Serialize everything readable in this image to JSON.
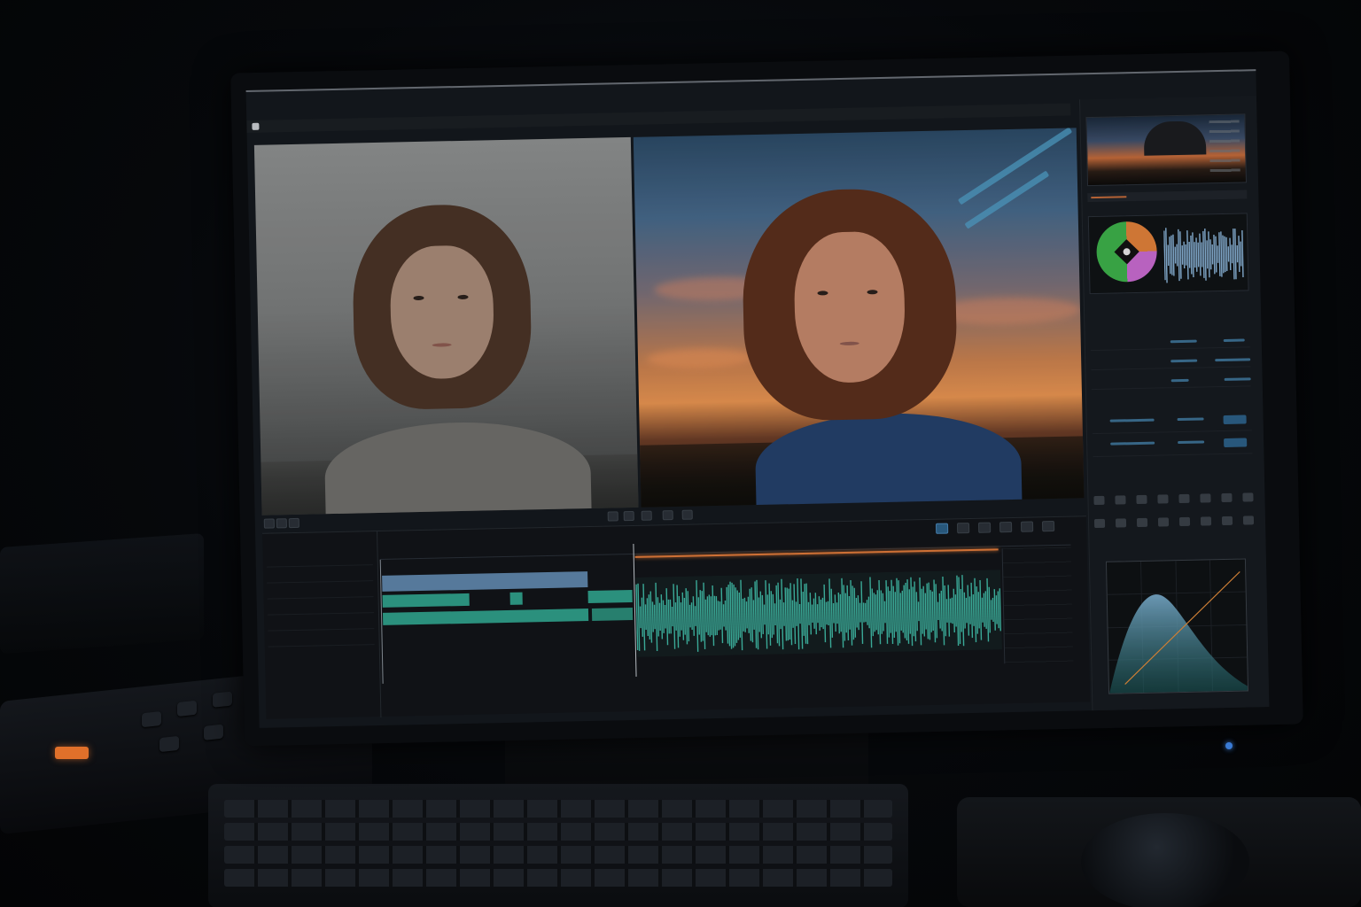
{
  "window": {
    "app_name": "",
    "title": "",
    "menu": [
      "",
      ""
    ]
  },
  "colors": {
    "accent_blue": "#2c5f86",
    "clip_blue": "#5e84a8",
    "clip_teal": "#2f9c88",
    "playhead_orange": "#e07a3a",
    "panel_bg": "#161a1f"
  },
  "viewers": {
    "left": {
      "description": "source-footage"
    },
    "right": {
      "description": "graded-footage"
    }
  },
  "right_panel": {
    "tabs": [
      "",
      ""
    ],
    "section_title": "",
    "rows": [
      {
        "label": ""
      },
      {
        "label": ""
      },
      {
        "label": ""
      }
    ],
    "sub_title_1": "",
    "sub_title_2": "",
    "sub_title_3": ""
  },
  "timeline": {
    "ruler_labels": [
      "",
      "",
      "",
      "",
      ""
    ],
    "tracks": [
      {
        "name": "",
        "label": ""
      },
      {
        "name": "",
        "label": ""
      },
      {
        "name": "",
        "label": ""
      },
      {
        "name": "",
        "label": ""
      },
      {
        "name": "",
        "label": ""
      },
      {
        "name": "",
        "label": ""
      }
    ]
  },
  "icons": {
    "transport": [
      "record-icon",
      "clip-icon",
      "grid-icon",
      "crop-icon",
      "marker-icon"
    ],
    "timeline_tools": [
      "select-icon",
      "blade-icon",
      "link-icon",
      "snap-icon",
      "marker-icon",
      "flag-icon"
    ]
  }
}
